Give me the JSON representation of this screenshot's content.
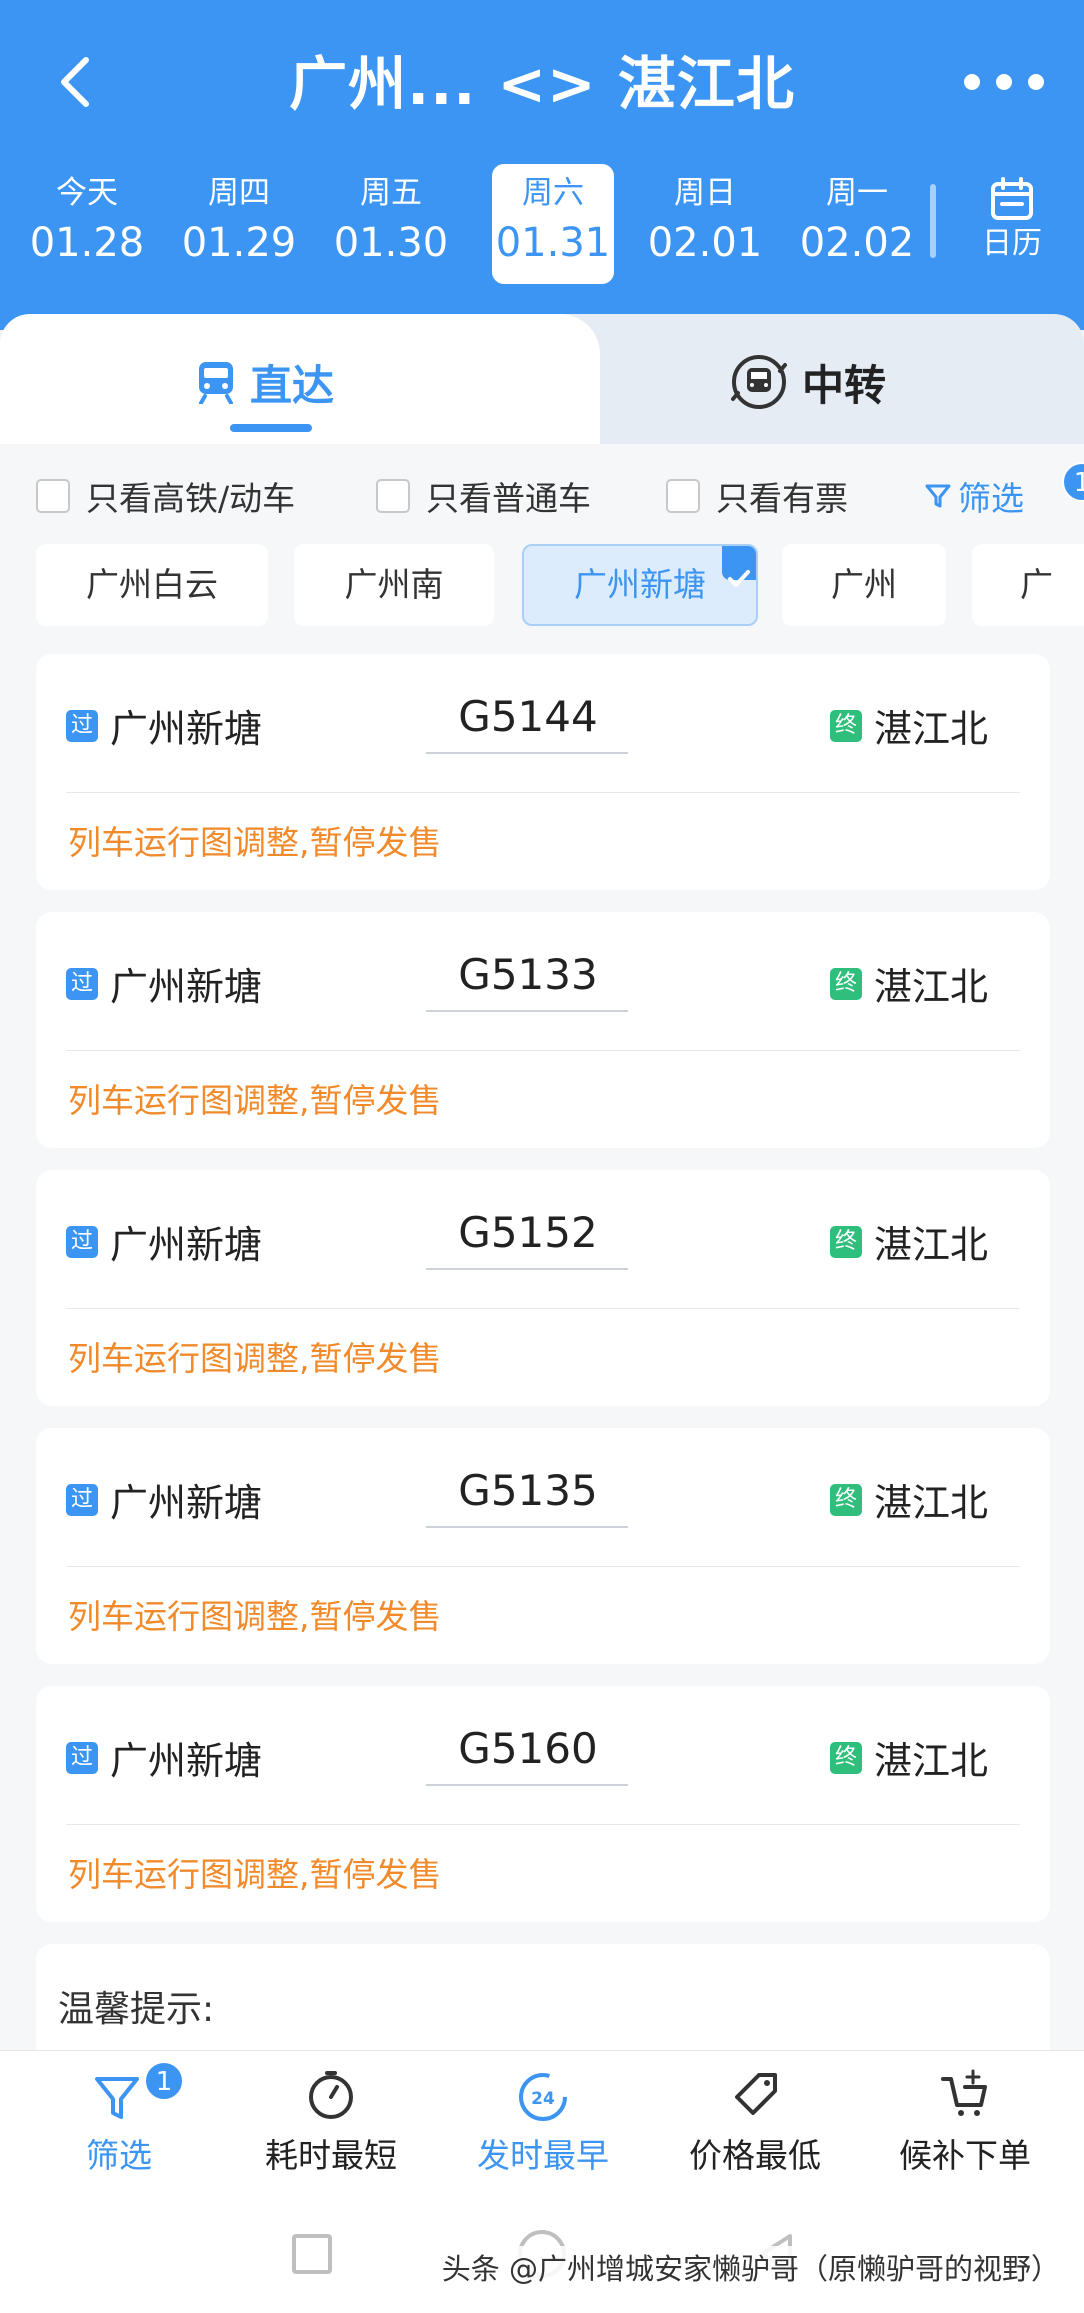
{
  "header": {
    "title": "广州... <> 湛江北",
    "back_icon": "chevron-left-icon",
    "more_icon": "more-dots-icon"
  },
  "dates": [
    {
      "weekday": "今天",
      "date": "01.28",
      "active": false
    },
    {
      "weekday": "周四",
      "date": "01.29",
      "active": false
    },
    {
      "weekday": "周五",
      "date": "01.30",
      "active": false
    },
    {
      "weekday": "周六",
      "date": "01.31",
      "active": true
    },
    {
      "weekday": "周日",
      "date": "02.01",
      "active": false
    },
    {
      "weekday": "周一",
      "date": "02.02",
      "active": false
    }
  ],
  "calendar": {
    "label": "日历",
    "icon": "calendar-icon"
  },
  "tabs": {
    "direct": "直达",
    "transfer": "中转"
  },
  "filters": {
    "high_speed": "只看高铁/动车",
    "normal": "只看普通车",
    "has_ticket": "只看有票",
    "filter_label": "筛选",
    "filter_badge": "1"
  },
  "stations": [
    "广州白云",
    "广州南",
    "广州新塘",
    "广州",
    "广"
  ],
  "trains": [
    {
      "pass_tag": "过",
      "from": "广州新塘",
      "train": "G5144",
      "end_tag": "终",
      "to": "湛江北",
      "status": "列车运行图调整,暂停发售"
    },
    {
      "pass_tag": "过",
      "from": "广州新塘",
      "train": "G5133",
      "end_tag": "终",
      "to": "湛江北",
      "status": "列车运行图调整,暂停发售"
    },
    {
      "pass_tag": "过",
      "from": "广州新塘",
      "train": "G5152",
      "end_tag": "终",
      "to": "湛江北",
      "status": "列车运行图调整,暂停发售"
    },
    {
      "pass_tag": "过",
      "from": "广州新塘",
      "train": "G5135",
      "end_tag": "终",
      "to": "湛江北",
      "status": "列车运行图调整,暂停发售"
    },
    {
      "pass_tag": "过",
      "from": "广州新塘",
      "train": "G5160",
      "end_tag": "终",
      "to": "湛江北",
      "status": "列车运行图调整,暂停发售"
    }
  ],
  "tips": {
    "title": "温馨提示:"
  },
  "bottom_bar": {
    "filter": "筛选",
    "filter_badge": "1",
    "shortest": "耗时最短",
    "earliest": "发时最早",
    "earliest_icon_text": "24",
    "cheapest": "价格最低",
    "waitlist": "候补下单"
  },
  "watermark": "头条 @广州增城安家懒驴哥（原懒驴哥的视野）",
  "colors": {
    "primary": "#3c95f2",
    "warning": "#f08a2a",
    "end_tag": "#2fbe7c"
  }
}
